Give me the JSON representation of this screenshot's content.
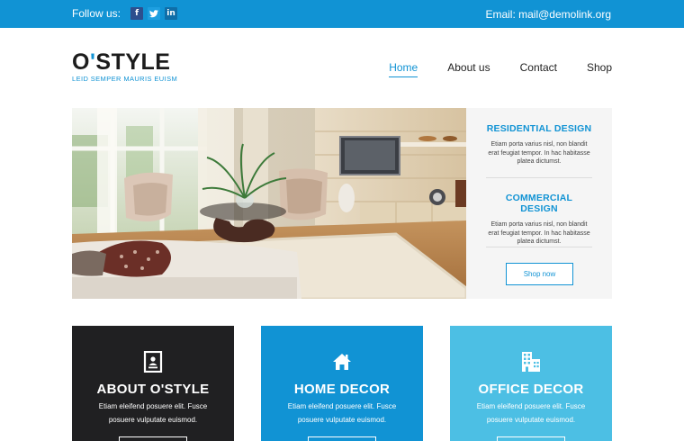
{
  "topbar": {
    "follow_label": "Follow us:",
    "social": [
      {
        "icon": "facebook-icon",
        "glyph": "f"
      },
      {
        "icon": "twitter-icon",
        "glyph": "t"
      },
      {
        "icon": "linkedin-icon",
        "glyph": "in"
      }
    ],
    "email": "Email: mail@demolink.org"
  },
  "header": {
    "logo_prefix": "O",
    "logo_quote": "'",
    "logo_suffix": "STYLE",
    "tagline": "LEID SEMPER MAURIS EUISM",
    "nav": [
      {
        "label": "Home",
        "active": true
      },
      {
        "label": "About us",
        "active": false
      },
      {
        "label": "Contact",
        "active": false
      },
      {
        "label": "Shop",
        "active": false
      }
    ]
  },
  "hero": {
    "services": [
      {
        "title": "RESIDENTIAL DESIGN",
        "text": "Etiam porta varius nisl, non blandit erat feugiat tempor. In hac habitasse platea dictumst."
      },
      {
        "title": "COMMERCIAL DESIGN",
        "text": "Etiam porta varius nisl, non blandit erat feugiat tempor. In hac habitasse platea dictumst."
      }
    ],
    "shop_button": "Shop now"
  },
  "features": [
    {
      "title": "ABOUT O'STYLE",
      "text": "Etiam eleifend posuere elit. Fusce posuere vulputate euismod.",
      "icon": "profile-card-icon"
    },
    {
      "title": "HOME DECOR",
      "text": "Etiam eleifend posuere elit. Fusce posuere vulputate euismod.",
      "icon": "home-icon"
    },
    {
      "title": "OFFICE DECOR",
      "text": "Etiam eleifend posuere elit. Fusce posuere vulputate euismod.",
      "icon": "office-building-icon"
    }
  ],
  "colors": {
    "accent": "#1193d4",
    "dark_box": "#202022",
    "light_box": "#4cbfe4"
  }
}
